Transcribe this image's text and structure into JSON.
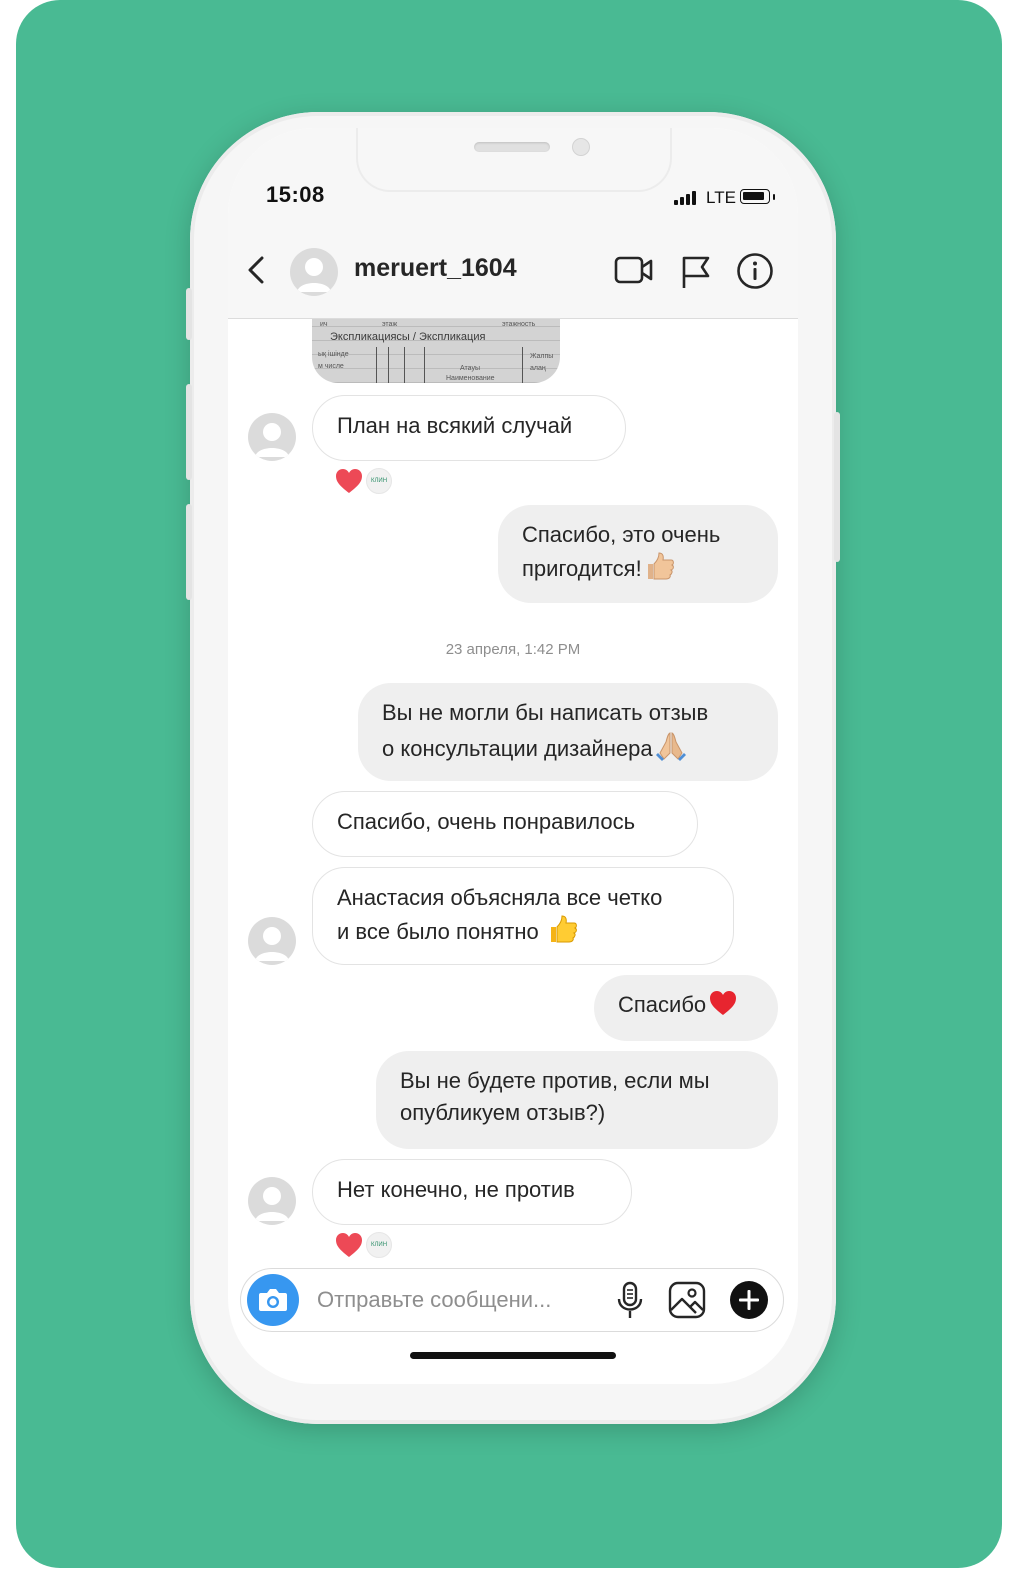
{
  "status_bar": {
    "time": "15:08",
    "network": "LTE"
  },
  "header": {
    "username": "meruert_1604",
    "icons": [
      "back-icon",
      "video-call-icon",
      "flag-icon",
      "info-icon"
    ]
  },
  "photo": {
    "title": "Экспликациясы / Экспликация",
    "header_words": [
      "этаж",
      "этажность"
    ],
    "fragments": [
      "ық ішінде",
      "м числе",
      "Атауы",
      "Наименование",
      "Жалпы",
      "алаң"
    ]
  },
  "messages": [
    {
      "side": "in",
      "text": "План на всякий случай",
      "reactions": [
        "heart",
        "clinic-avatar"
      ]
    },
    {
      "side": "out",
      "lines": [
        "Спасибо, это очень",
        "пригодится!"
      ],
      "emoji": "thumbs-up"
    },
    {
      "side": "timestamp",
      "text": "23 апреля, 1:42 PM"
    },
    {
      "side": "out",
      "lines": [
        "Вы не могли бы написать отзыв",
        "о консультации дизайнера"
      ],
      "emoji": "folded-hands"
    },
    {
      "side": "in",
      "text": "Спасибо, очень понравилось"
    },
    {
      "side": "in",
      "lines": [
        "Анастасия объясняла все четко",
        "и все было понятно "
      ],
      "emoji": "thumbs-up"
    },
    {
      "side": "out",
      "text": "Спасибо",
      "emoji": "red-heart"
    },
    {
      "side": "out",
      "lines": [
        "Вы не будете против, если мы",
        "опубликуем отзыв?)"
      ]
    },
    {
      "side": "in",
      "text": "Нет конечно, не против",
      "reactions": [
        "heart",
        "clinic-avatar"
      ]
    }
  ],
  "reaction_avatar_text": "КЛИН",
  "composer": {
    "placeholder": "Отправьте сообщени...",
    "icons": [
      "camera-icon",
      "microphone-icon",
      "gallery-icon",
      "add-icon"
    ]
  },
  "colors": {
    "background": "#49ba93",
    "heart": "#ed4956",
    "camera_button": "#3797f0",
    "outgoing_bubble": "#efefef",
    "incoming_border": "#e3e3e3"
  }
}
